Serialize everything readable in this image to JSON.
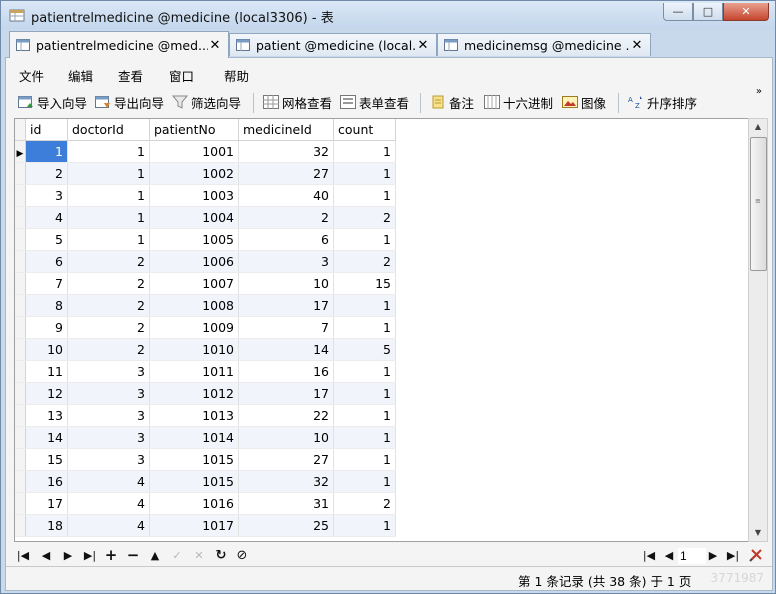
{
  "window": {
    "title": "patientrelmedicine @medicine (local3306) - 表",
    "buttons": {
      "minimize": "—",
      "maximize": "□",
      "close": "✕"
    }
  },
  "tabs": [
    {
      "label": "patientrelmedicine @med...",
      "close": "✕",
      "active": true
    },
    {
      "label": "patient @medicine (local...",
      "close": "✕",
      "active": false
    },
    {
      "label": "medicinemsg @medicine ...",
      "close": "✕",
      "active": false
    }
  ],
  "menu": [
    "文件",
    "编辑",
    "查看",
    "窗口",
    "帮助"
  ],
  "toolbar": {
    "import": "导入向导",
    "export": "导出向导",
    "filter": "筛选向导",
    "grid_view": "网格查看",
    "form_view": "表单查看",
    "memo": "备注",
    "hex": "十六进制",
    "image": "图像",
    "sort": "升序排序",
    "more": "»"
  },
  "table": {
    "columns": [
      "id",
      "doctorId",
      "patientNo",
      "medicineId",
      "count"
    ],
    "rows": [
      [
        "1",
        "1",
        "1001",
        "32",
        "1"
      ],
      [
        "2",
        "1",
        "1002",
        "27",
        "1"
      ],
      [
        "3",
        "1",
        "1003",
        "40",
        "1"
      ],
      [
        "4",
        "1",
        "1004",
        "2",
        "2"
      ],
      [
        "5",
        "1",
        "1005",
        "6",
        "1"
      ],
      [
        "6",
        "2",
        "1006",
        "3",
        "2"
      ],
      [
        "7",
        "2",
        "1007",
        "10",
        "15"
      ],
      [
        "8",
        "2",
        "1008",
        "17",
        "1"
      ],
      [
        "9",
        "2",
        "1009",
        "7",
        "1"
      ],
      [
        "10",
        "2",
        "1010",
        "14",
        "5"
      ],
      [
        "11",
        "3",
        "1011",
        "16",
        "1"
      ],
      [
        "12",
        "3",
        "1012",
        "17",
        "1"
      ],
      [
        "13",
        "3",
        "1013",
        "22",
        "1"
      ],
      [
        "14",
        "3",
        "1014",
        "10",
        "1"
      ],
      [
        "15",
        "3",
        "1015",
        "27",
        "1"
      ],
      [
        "16",
        "4",
        "1015",
        "32",
        "1"
      ],
      [
        "17",
        "4",
        "1016",
        "31",
        "2"
      ],
      [
        "18",
        "4",
        "1017",
        "25",
        "1"
      ]
    ],
    "selected_row": 0
  },
  "nav": {
    "page_value": "1",
    "glyphs": {
      "first": "|◀",
      "prev": "◀",
      "next": "▶",
      "last": "▶|",
      "add": "+",
      "delete": "−",
      "up": "▲",
      "confirm": "✓",
      "cancel": "✕",
      "refresh": "↻",
      "stop": "⊘"
    }
  },
  "status": {
    "text": "第 1 条记录 (共 38 条) 于 1 页",
    "watermark": "3771987"
  }
}
